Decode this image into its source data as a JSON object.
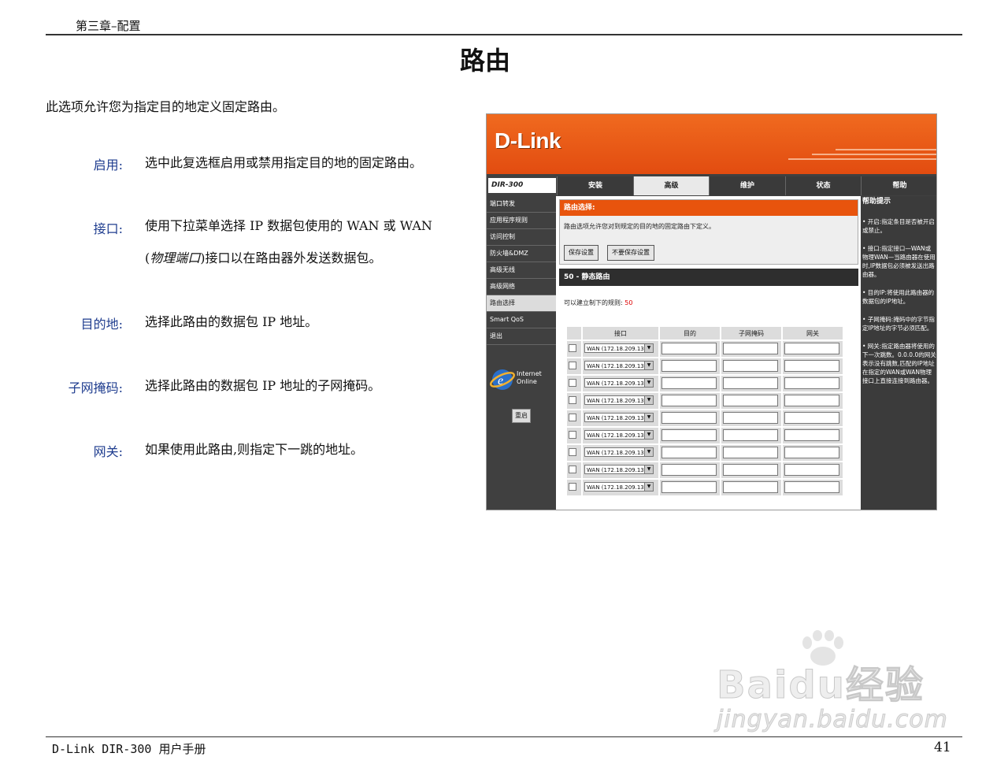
{
  "header": {
    "chapter": "第三章–配置",
    "title": "路由"
  },
  "intro": "此选项允许您为指定目的地定义固定路由。",
  "fields": [
    {
      "term": "启用:",
      "desc": "选中此复选框启用或禁用指定目的地的固定路由。"
    },
    {
      "term": "接口:",
      "desc_line1": "使用下拉菜单选择 IP 数据包使用的 WAN 或 WAN",
      "desc_line2_open": "(",
      "desc_line2_italic": "物理端口",
      "desc_line2_rest": ")接口以在路由器外发送数据包。"
    },
    {
      "term": "目的地:",
      "desc": "选择此路由的数据包 IP 地址。"
    },
    {
      "term": "子网掩码:",
      "desc": "选择此路由的数据包 IP 地址的子网掩码。"
    },
    {
      "term": "网关:",
      "desc": "如果使用此路由,则指定下一跳的地址。"
    }
  ],
  "screenshot": {
    "logo": "D-Link",
    "model": "DIR-300",
    "tabs": [
      "安装",
      "高级",
      "维护",
      "状态",
      "帮助"
    ],
    "active_tab": "高级",
    "left_nav": [
      "端口转发",
      "应用程序规则",
      "访问控制",
      "防火墙&DMZ",
      "高级无线",
      "高级网络",
      "路由选择",
      "Smart QoS",
      "退出"
    ],
    "active_nav": "路由选择",
    "ie_text": [
      "Internet",
      "Online"
    ],
    "reboot": "重启",
    "section1_title": "路由选择:",
    "section1_text": "路由选项允许您对到规定的目的地的固定路由下定义。",
    "save_button": "保存设置",
    "nosave_button": "不要保存设置",
    "section2_title": "50 - 静态路由",
    "limit_text": "可以建立制下的规则:",
    "limit_value": "50",
    "table_headers": [
      "接口",
      "目的",
      "子网掩码",
      "网关"
    ],
    "interface_value": "WAN (172.18.209.13)",
    "help_title": "帮助提示",
    "help_items": [
      "• 开启:指定条目是否被开启或禁止。",
      "• 接口:指定接口—WAN或物理WAN—当路由器在使用时,IP数据包必须被发送出路由器。",
      "• 目的IP:将使用此路由器的数据包的IP地址。",
      "• 子网掩码:掩码中的字节指定IP地址的字节必须匹配。",
      "• 网关:指定路由器将使用的下一次跳数。0.0.0.0的网关表示没有跳数,匹配的IP地址在指定的WAN或WAN物理接口上直接连接到路由器。"
    ]
  },
  "footer": {
    "left": "D-Link DIR-300 用户手册",
    "page": "41"
  },
  "watermark": {
    "main": "Baidu经验",
    "sub": "jingyan.baidu.com"
  }
}
